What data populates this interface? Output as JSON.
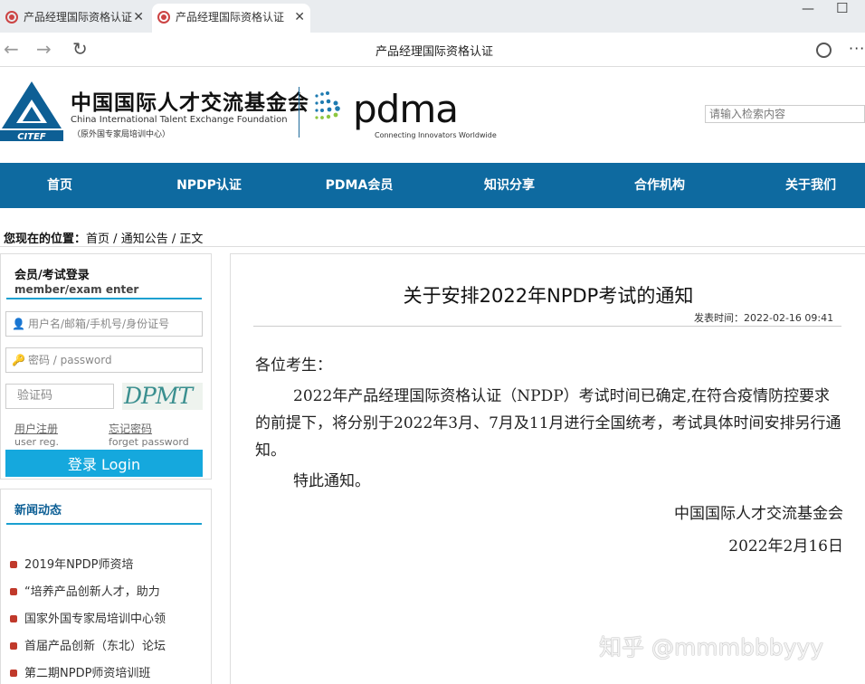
{
  "browser": {
    "tabs": [
      {
        "title": "产品经理国际资格认证"
      },
      {
        "title": "产品经理国际资格认证"
      }
    ],
    "address_title": "产品经理国际资格认证",
    "icons": {
      "back": "back-arrow-icon",
      "forward": "forward-arrow-icon",
      "reload": "reload-icon",
      "more": "more-icon"
    },
    "more_label": "···"
  },
  "header": {
    "org_cn": "中国国际人才交流基金会",
    "org_en": "China International Talent Exchange Foundation",
    "org_sub": "（原外国专家局培训中心）",
    "logo_text": "CITEF",
    "pdma": "pdma",
    "pdma_tagline": "Connecting Innovators Worldwide",
    "search_placeholder": "请输入检索内容"
  },
  "nav": {
    "items": [
      {
        "label": "首页"
      },
      {
        "label": "NPDP认证"
      },
      {
        "label": "PDMA会员"
      },
      {
        "label": "知识分享"
      },
      {
        "label": "合作机构"
      },
      {
        "label": "关于我们"
      }
    ]
  },
  "breadcrumb": {
    "prefix": "您现在的位置：",
    "items": [
      "首页",
      "通知公告",
      "正文"
    ],
    "separator": " / "
  },
  "login": {
    "title": "会员/考试登录",
    "subtitle": "member/exam enter",
    "username_placeholder": "用户名/邮箱/手机号/身份证号",
    "password_placeholder": "密码 / password",
    "captcha_placeholder": "验证码",
    "captcha_text": "DPMT",
    "register": "用户注册",
    "register_en": "user reg.",
    "forgot": "忘记密码",
    "forgot_en": "forget password",
    "submit": "登录 Login"
  },
  "news": {
    "title": "新闻动态",
    "items": [
      "2019年NPDP师资培",
      "“培养产品创新人才，助力",
      "国家外国专家局培训中心领",
      "首届产品创新（东北）论坛",
      "第二期NPDP师资培训班"
    ]
  },
  "article": {
    "title": "关于安排2022年NPDP考试的通知",
    "time_label": "发表时间：",
    "time": "2022-02-16 09:41",
    "salutation": "各位考生：",
    "body": "2022年产品经理国际资格认证（NPDP）考试时间已确定,在符合疫情防控要求的前提下，将分别于2022年3月、7月及11月进行全国统考，考试具体时间安排另行通知。",
    "notice": "特此通知。",
    "signature": "中国国际人才交流基金会",
    "date": "2022年2月16日"
  },
  "watermark": "知乎 @mmmbbbyyy"
}
